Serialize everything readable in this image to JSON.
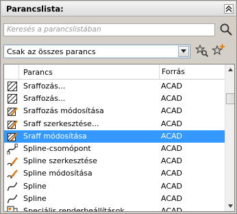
{
  "panel": {
    "title": "Parancslista:"
  },
  "search": {
    "placeholder": "Keresés a parancslistában"
  },
  "filter": {
    "selected": "Csak az összes parancs"
  },
  "table": {
    "columns": {
      "name": "Parancs",
      "source": "Forrás"
    },
    "rows": [
      {
        "name": "Sraffozás...",
        "source": "ACAD",
        "icon": "hatch-icon"
      },
      {
        "name": "Sraffozás...",
        "source": "ACAD",
        "icon": "hatch-icon"
      },
      {
        "name": "Sraffozás módosítása",
        "source": "ACAD",
        "icon": "hatch-edit-icon"
      },
      {
        "name": "Sraff szerkesztése...",
        "source": "ACAD",
        "icon": "hatch-edit-icon"
      },
      {
        "name": "Sraff módosítása",
        "source": "ACAD",
        "icon": "hatch-edit-icon",
        "selected": true
      },
      {
        "name": "Spline-csomópont",
        "source": "ACAD",
        "icon": "spline-knot-icon"
      },
      {
        "name": "Spline szerkesztése",
        "source": "ACAD",
        "icon": "spline-edit-icon"
      },
      {
        "name": "Spline módosítása",
        "source": "ACAD",
        "icon": "spline-edit-icon"
      },
      {
        "name": "Spline",
        "source": "ACAD",
        "icon": "spline-icon"
      },
      {
        "name": "Spline",
        "source": "ACAD",
        "icon": "spline-icon"
      },
      {
        "name": "Speciális renderbeállítások",
        "source": "ACAD",
        "icon": "render-settings-icon"
      }
    ]
  },
  "colors": {
    "selection": "#3399ff"
  }
}
